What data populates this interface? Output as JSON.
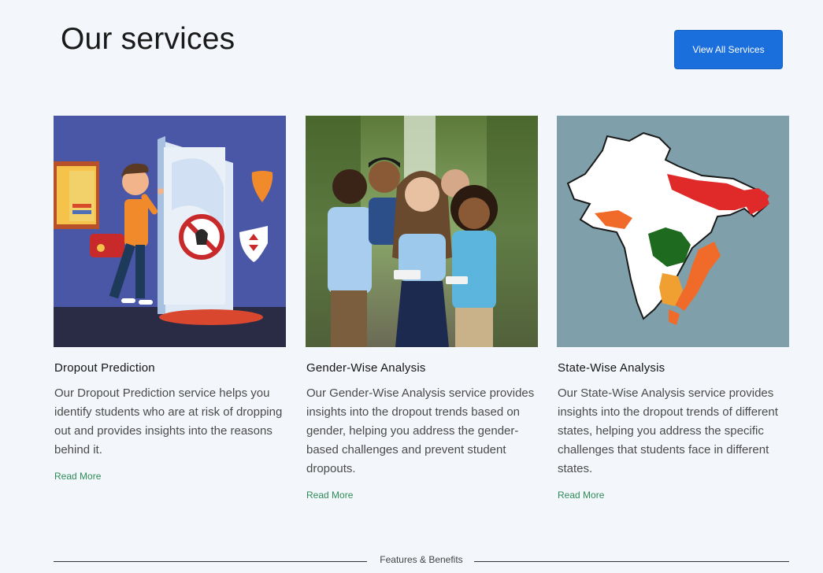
{
  "header": {
    "title": "Our services",
    "view_all_label": "View All Services"
  },
  "cards": [
    {
      "title": "Dropout Prediction",
      "description": "Our Dropout Prediction service helps you identify students who are at risk of dropping out and provides insights into the reasons behind it.",
      "link_label": "Read More",
      "image": "dropout-illustration"
    },
    {
      "title": "Gender-Wise Analysis",
      "description": "Our Gender-Wise Analysis service provides insights into the dropout trends based on gender, helping you address the gender-based challenges and prevent student dropouts.",
      "link_label": "Read More",
      "image": "students-photo"
    },
    {
      "title": "State-Wise Analysis",
      "description": "Our State-Wise Analysis service provides insights into the dropout trends of different states, helping you address the specific challenges that students face in different states.",
      "link_label": "Read More",
      "image": "india-map-illustration"
    }
  ],
  "footer_divider": {
    "label": "Features & Benefits"
  },
  "colors": {
    "accent": "#1a6fdc",
    "link": "#2e8b57",
    "background": "#f3f6fb"
  }
}
